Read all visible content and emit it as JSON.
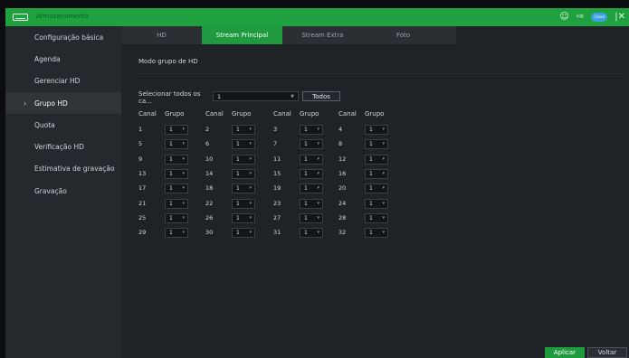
{
  "window": {
    "title": "Armazenamento",
    "icons": [
      "hdd-icon",
      "user-icon",
      "exit-icon",
      "cloud-icon",
      "close-icon"
    ],
    "cloud_label": "Cloud",
    "accent": "#1f9a3f"
  },
  "sidebar": {
    "items": [
      {
        "label": "Configuração básica"
      },
      {
        "label": "Agenda"
      },
      {
        "label": "Gerenciar HD"
      },
      {
        "label": "Grupo HD",
        "active": true
      },
      {
        "label": "Quota"
      },
      {
        "label": "Verificação HD"
      },
      {
        "label": "Estimativa de gravação"
      },
      {
        "label": "Gravação"
      }
    ]
  },
  "tabs": [
    {
      "label": "HD"
    },
    {
      "label": "Stream Principal",
      "active": true
    },
    {
      "label": "Stream Extra"
    },
    {
      "label": "Foto"
    }
  ],
  "main": {
    "section_title": "Modo grupo de HD",
    "select_all_label": "Selecionar todos os ca...",
    "select_all_value": "1",
    "todos_label": "Todos",
    "headers": {
      "canal": "Canal",
      "grupo": "Grupo"
    },
    "rows": [
      [
        {
          "ch": "1",
          "g": "1"
        },
        {
          "ch": "2",
          "g": "1"
        },
        {
          "ch": "3",
          "g": "1"
        },
        {
          "ch": "4",
          "g": "1"
        }
      ],
      [
        {
          "ch": "5",
          "g": "1"
        },
        {
          "ch": "6",
          "g": "1"
        },
        {
          "ch": "7",
          "g": "1"
        },
        {
          "ch": "8",
          "g": "1"
        }
      ],
      [
        {
          "ch": "9",
          "g": "1"
        },
        {
          "ch": "10",
          "g": "1"
        },
        {
          "ch": "11",
          "g": "1"
        },
        {
          "ch": "12",
          "g": "1"
        }
      ],
      [
        {
          "ch": "13",
          "g": "1"
        },
        {
          "ch": "14",
          "g": "1"
        },
        {
          "ch": "15",
          "g": "1"
        },
        {
          "ch": "16",
          "g": "1"
        }
      ],
      [
        {
          "ch": "17",
          "g": "1"
        },
        {
          "ch": "18",
          "g": "1"
        },
        {
          "ch": "19",
          "g": "1"
        },
        {
          "ch": "20",
          "g": "1"
        }
      ],
      [
        {
          "ch": "21",
          "g": "1"
        },
        {
          "ch": "22",
          "g": "1"
        },
        {
          "ch": "23",
          "g": "1"
        },
        {
          "ch": "24",
          "g": "1"
        }
      ],
      [
        {
          "ch": "25",
          "g": "1"
        },
        {
          "ch": "26",
          "g": "1"
        },
        {
          "ch": "27",
          "g": "1"
        },
        {
          "ch": "28",
          "g": "1"
        }
      ],
      [
        {
          "ch": "29",
          "g": "1"
        },
        {
          "ch": "30",
          "g": "1"
        },
        {
          "ch": "31",
          "g": "1"
        },
        {
          "ch": "32",
          "g": "1"
        }
      ]
    ]
  },
  "footer": {
    "apply_label": "Aplicar",
    "back_label": "Voltar"
  }
}
